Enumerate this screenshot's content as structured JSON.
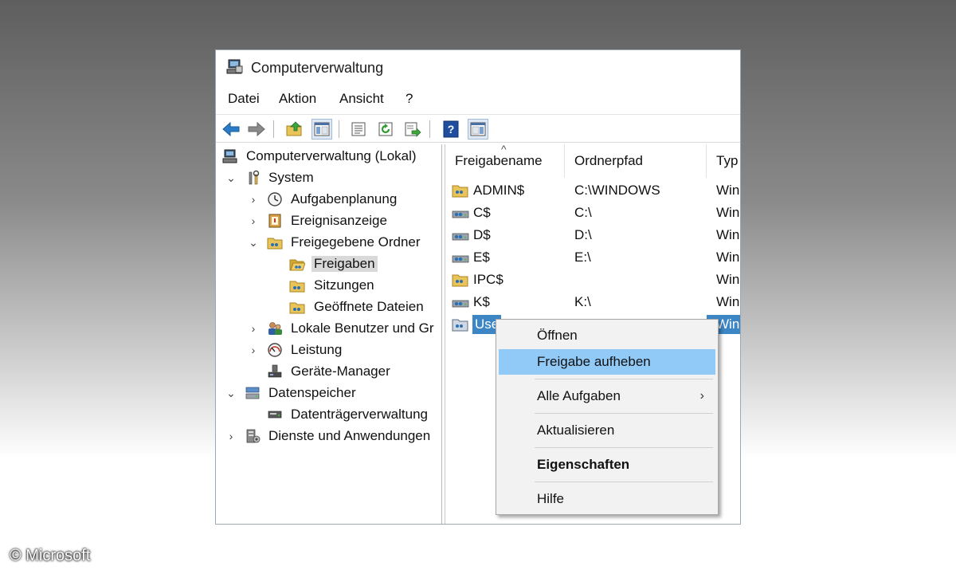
{
  "window": {
    "title": "Computerverwaltung"
  },
  "menubar": {
    "items": [
      "Datei",
      "Aktion",
      "Ansicht",
      "?"
    ]
  },
  "tree": {
    "root": "Computerverwaltung (Lokal)",
    "system": "System",
    "aufgabenplanung": "Aufgabenplanung",
    "ereignisanzeige": "Ereignisanzeige",
    "freigegebene_ordner": "Freigegebene Ordner",
    "freigaben": "Freigaben",
    "sitzungen": "Sitzungen",
    "geoeffnete_dateien": "Geöffnete Dateien",
    "lokale_benutzer": "Lokale Benutzer und Gr",
    "leistung": "Leistung",
    "geraete_manager": "Geräte-Manager",
    "datenspeicher": "Datenspeicher",
    "datentraegerverwaltung": "Datenträgerverwaltung",
    "dienste": "Dienste und Anwendungen"
  },
  "list": {
    "columns": [
      "Freigabename",
      "Ordnerpfad",
      "Typ"
    ],
    "rows": [
      {
        "name": "ADMIN$",
        "path": "C:\\WINDOWS",
        "type": "Win"
      },
      {
        "name": "C$",
        "path": "C:\\",
        "type": "Win"
      },
      {
        "name": "D$",
        "path": "D:\\",
        "type": "Win"
      },
      {
        "name": "E$",
        "path": "E:\\",
        "type": "Win"
      },
      {
        "name": "IPC$",
        "path": "",
        "type": "Win"
      },
      {
        "name": "K$",
        "path": "K:\\",
        "type": "Win"
      },
      {
        "name": "Use",
        "path": "",
        "type": "Win"
      }
    ]
  },
  "context_menu": {
    "open": "Öffnen",
    "unshare": "Freigabe aufheben",
    "all_tasks": "Alle Aufgaben",
    "refresh": "Aktualisieren",
    "properties": "Eigenschaften",
    "help": "Hilfe"
  },
  "copyright": "© Microsoft",
  "colors": {
    "selection": "#3d86c6",
    "menu_hover": "#91c9f7"
  }
}
